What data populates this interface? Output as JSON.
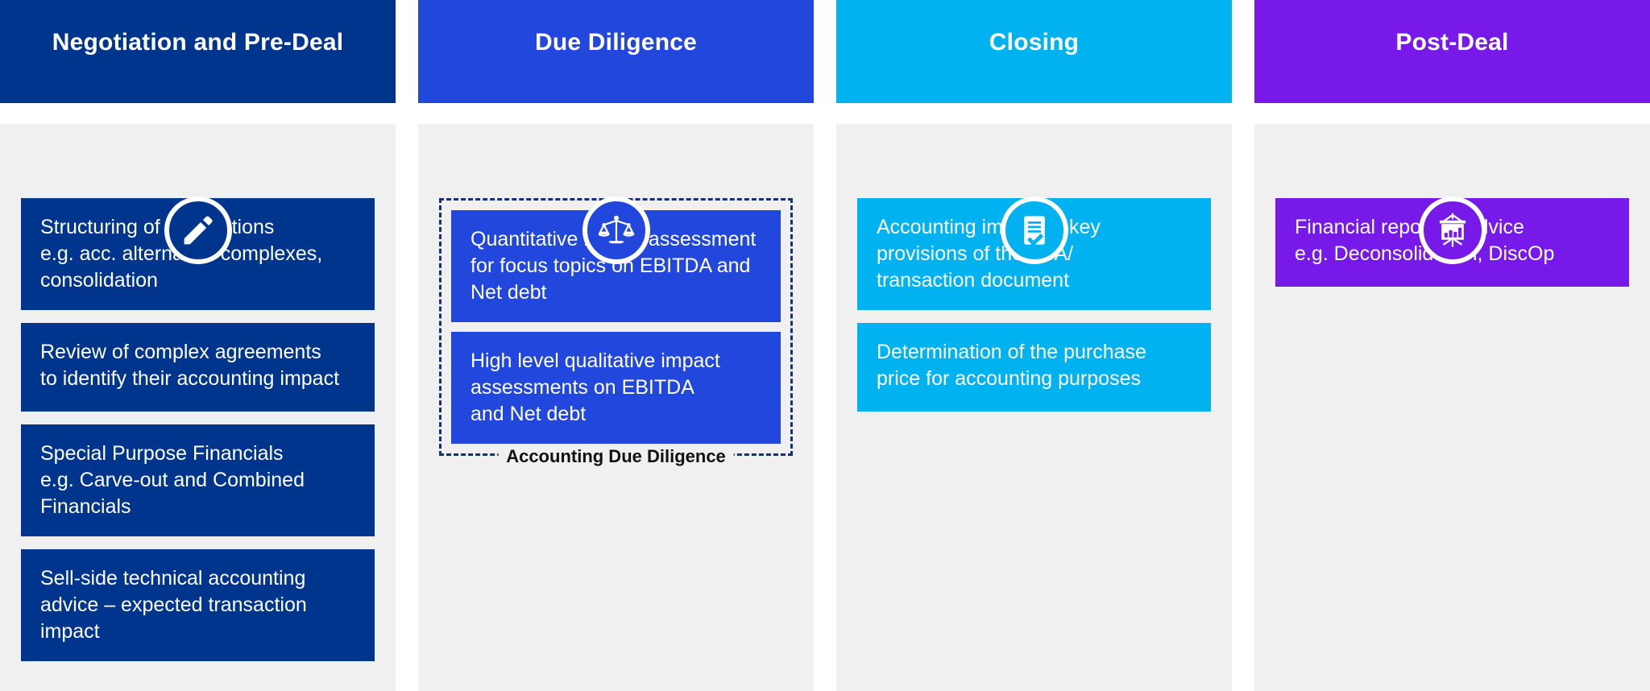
{
  "columns": [
    {
      "id": "negotiation",
      "title": "Negotiation and Pre-Deal",
      "color": "#00358E",
      "icon": "pencil-icon",
      "cards": [
        "Structuring of transactions\ne.g. acc. alternative complexes,\nconsolidation",
        "Review of complex agreements\nto identify their accounting impact",
        "Special Purpose Financials\ne.g. Carve-out and Combined\nFinancials",
        "Sell-side technical accounting\nadvice – expected transaction\nimpact"
      ]
    },
    {
      "id": "due-diligence",
      "title": "Due Diligence",
      "color": "#2147DC",
      "icon": "scales-icon",
      "group_caption": "Accounting Due Diligence",
      "cards": [
        "Quantitative impact assessment\nfor focus topics on EBITDA and\nNet debt",
        "High level qualitative impact\nassessments on EBITDA\nand Net debt"
      ]
    },
    {
      "id": "closing",
      "title": "Closing",
      "color": "#00B2EF",
      "icon": "document-check-icon",
      "cards": [
        "Accounting impact of key\nprovisions of the SPA/\ntransaction document",
        "Determination of the purchase\nprice for accounting purposes"
      ]
    },
    {
      "id": "post-deal",
      "title": "Post-Deal",
      "color": "#7719E8",
      "icon": "presentation-chart-icon",
      "cards": [
        "Financial reporting advice\n e.g. Deconsolidation, DiscOp"
      ]
    }
  ],
  "palette": {
    "body_background": "#f0f0f0",
    "page_background": "#ffffff",
    "dashed_border": "#13307a",
    "card_text": "#ffffff",
    "caption_text": "#111111"
  }
}
